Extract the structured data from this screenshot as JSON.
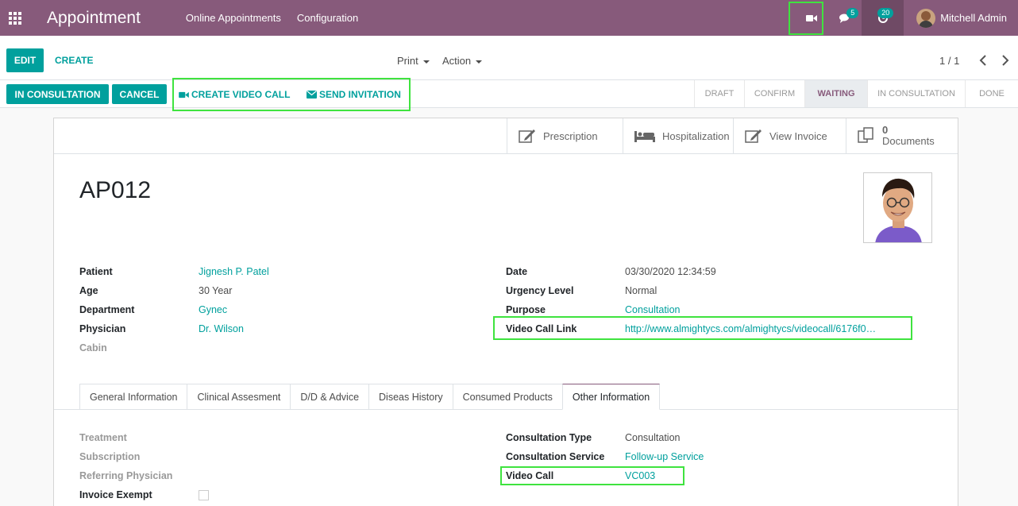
{
  "navbar": {
    "app_title": "Appointment",
    "menus": [
      "Online Appointments",
      "Configuration"
    ],
    "chat_count": "5",
    "activity_count": "20",
    "user_name": "Mitchell Admin"
  },
  "control": {
    "edit_label": "EDIT",
    "create_label": "CREATE",
    "print_label": "Print",
    "action_label": "Action",
    "pager": "1 / 1"
  },
  "statusbar": {
    "in_consultation_label": "IN CONSULTATION",
    "cancel_label": "CANCEL",
    "create_video_call_label": "CREATE VIDEO CALL",
    "send_invitation_label": "SEND INVITATION",
    "steps": [
      "DRAFT",
      "CONFIRM",
      "WAITING",
      "IN CONSULTATION",
      "DONE"
    ],
    "active_step": "WAITING"
  },
  "smart_buttons": {
    "prescription": "Prescription",
    "hospitalization": "Hospitalization",
    "view_invoice": "View Invoice",
    "documents_count": "0",
    "documents_label": "Documents"
  },
  "record": {
    "name": "AP012",
    "left": [
      {
        "label": "Patient",
        "value": "Jignesh P. Patel"
      },
      {
        "label": "Age",
        "value": "30 Year"
      },
      {
        "label": "Department",
        "value": "Gynec"
      },
      {
        "label": "Physician",
        "value": "Dr. Wilson"
      },
      {
        "label": "Cabin",
        "value": ""
      }
    ],
    "right": [
      {
        "label": "Date",
        "value": "03/30/2020 12:34:59"
      },
      {
        "label": "Urgency Level",
        "value": "Normal"
      },
      {
        "label": "Purpose",
        "value": "Consultation"
      },
      {
        "label": "Video Call Link",
        "value": "http://www.almightycs.com/almightycs/videocall/6176f0…"
      }
    ]
  },
  "tabs": [
    "General Information",
    "Clinical Assesment",
    "D/D & Advice",
    "Diseas History",
    "Consumed Products",
    "Other Information"
  ],
  "other_info": {
    "left": [
      {
        "label": "Treatment"
      },
      {
        "label": "Subscription"
      },
      {
        "label": "Referring Physician"
      },
      {
        "label": "Invoice Exempt"
      }
    ],
    "right": [
      {
        "label": "Consultation Type",
        "value": "Consultation"
      },
      {
        "label": "Consultation Service",
        "value": "Follow-up Service"
      },
      {
        "label": "Video Call",
        "value": "VC003"
      }
    ]
  },
  "colors": {
    "brand": "#875a7b",
    "accent": "#00a09d",
    "highlight": "#3fe33f"
  }
}
